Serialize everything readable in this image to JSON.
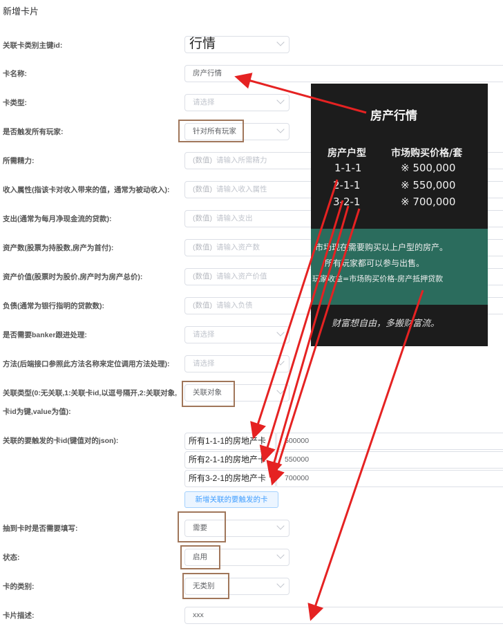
{
  "page": {
    "title": "新增卡片"
  },
  "form": {
    "card_type_id": {
      "label": "关联卡类别主键id:",
      "value": "行情"
    },
    "card_name": {
      "label": "卡名称:",
      "value": "房产行情"
    },
    "card_kind": {
      "label": "卡类型:",
      "placeholder": "请选择"
    },
    "trigger_all": {
      "label": "是否触发所有玩家:",
      "value": "针对所有玩家"
    },
    "energy": {
      "label": "所需精力:",
      "prefix": "(数值)",
      "placeholder": "请输入所需精力"
    },
    "income": {
      "label": "收入属性(指该卡对收入带来的值，通常为被动收入):",
      "prefix": "(数值)",
      "placeholder": "请输入收入属性"
    },
    "expense": {
      "label": "支出(通常为每月净现金流的贷款):",
      "prefix": "(数值)",
      "placeholder": "请输入支出"
    },
    "asset_count": {
      "label": "资产数(股票为持股数,房产为首付):",
      "prefix": "(数值)",
      "placeholder": "请输入资产数"
    },
    "asset_value": {
      "label": "资产价值(股票时为股价,房产时为房产总价):",
      "prefix": "(数值)",
      "placeholder": "请输入资产价值"
    },
    "debt": {
      "label": "负债(通常为银行指明的贷款数):",
      "prefix": "(数值)",
      "placeholder": "请输入负债"
    },
    "banker": {
      "label": "是否需要banker跟进处理:",
      "placeholder": "请选择"
    },
    "method": {
      "label": "方法(后端接口参照此方法名称来定位调用方法处理):",
      "placeholder": "请选择"
    },
    "link_type": {
      "label_line1": "关联类型(0:无关联,1:关联卡id,以逗号隔开,2:关联对象,",
      "label_line2": "卡id为键,value为值):",
      "value": "关联对象"
    },
    "trigger_cards": {
      "label": "关联的要触发的卡id(键值对的json):",
      "rows": [
        {
          "key": "所有1-1-1的房地产卡",
          "value": "500000"
        },
        {
          "key": "所有2-1-1的房地产卡",
          "value": "550000"
        },
        {
          "key": "所有3-2-1的房地产卡",
          "value": "700000"
        }
      ],
      "add_label": "新增关联的要触发的卡"
    },
    "need_fill": {
      "label": "抽到卡时是否需要填写:",
      "value": "需要"
    },
    "status": {
      "label": "状态:",
      "value": "启用"
    },
    "category": {
      "label": "卡的类别:",
      "value": "无类别"
    },
    "description": {
      "label": "卡片描述:",
      "value": "xxx"
    }
  },
  "photo": {
    "title": "房产行情",
    "col1": "房产户型",
    "col2": "市场购买价格/套",
    "rows": [
      {
        "type": "1-1-1",
        "price": "※ 500,000"
      },
      {
        "type": "2-1-1",
        "price": "※ 550,000"
      },
      {
        "type": "3-2-1",
        "price": "※ 700,000"
      }
    ],
    "line1": "市场现在需要购买以上户型的房产。",
    "line2": "所有玩家都可以参与出售。",
    "line3": "玩家收益=市场购买价格-房产抵押贷款",
    "footer": "财富想自由，多搬财富流。"
  },
  "colors": {
    "arrow": "#e52222",
    "highlight_box": "#a0765a",
    "primary": "#409eff"
  }
}
